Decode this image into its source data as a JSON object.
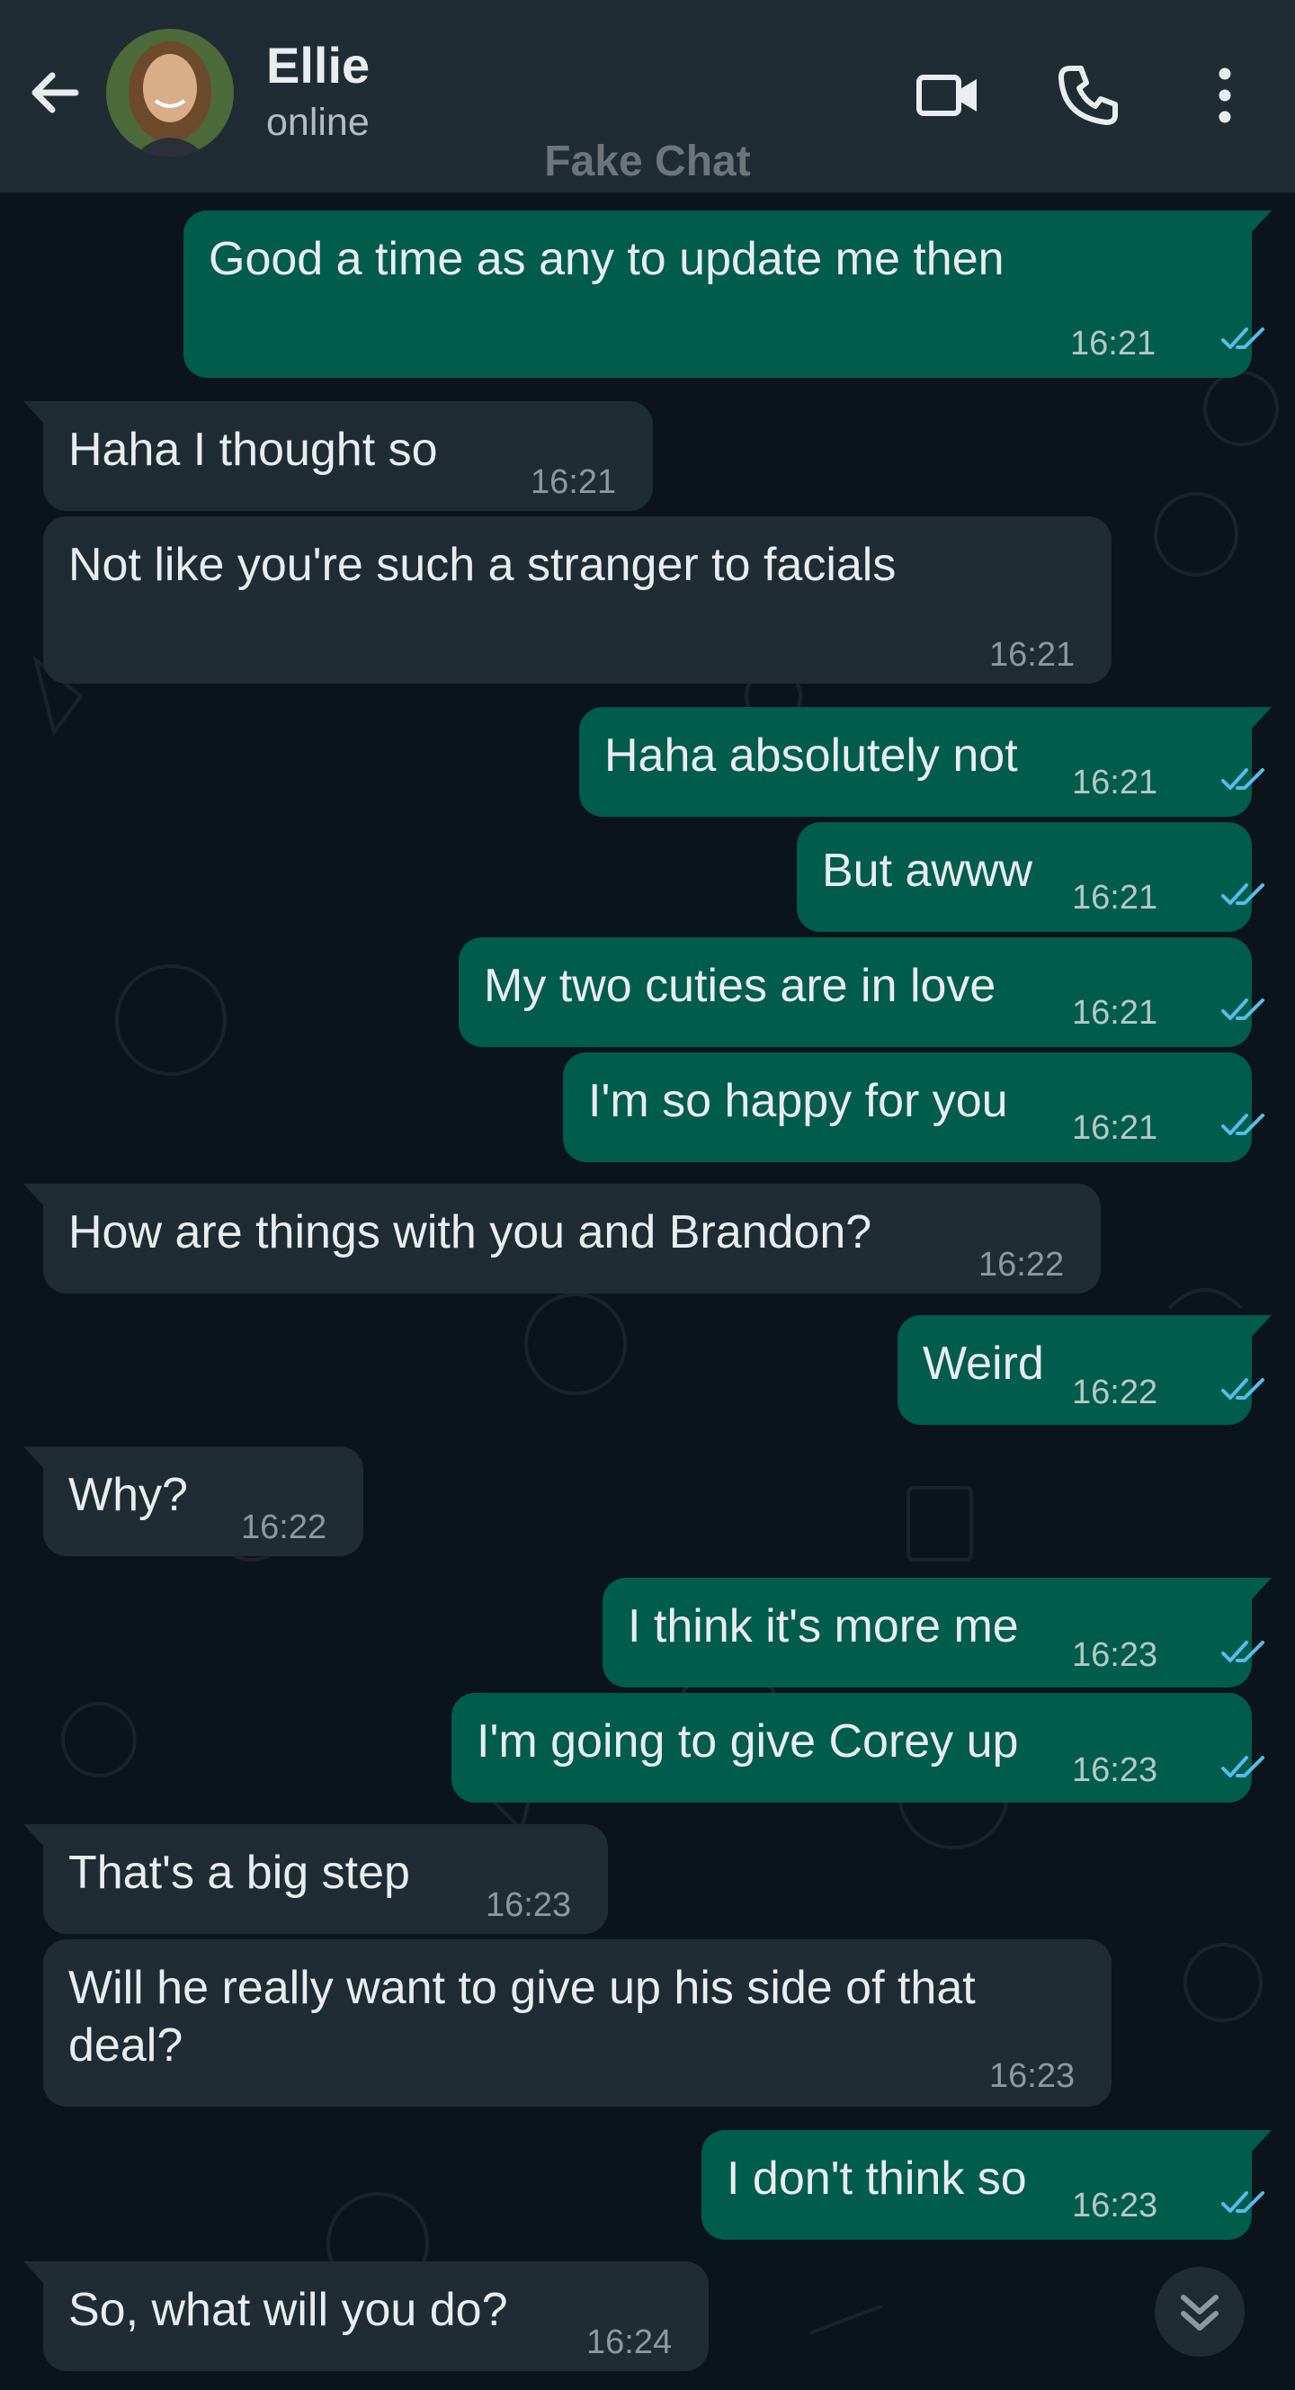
{
  "header": {
    "contact_name": "Ellie",
    "status": "online",
    "watermark": "Fake Chat",
    "icons": [
      "back-arrow-icon",
      "video-call-icon",
      "voice-call-icon",
      "more-options-icon"
    ]
  },
  "colors": {
    "header_bg": "#1f2c34",
    "chat_bg": "#0b141a",
    "outgoing_bubble": "#005c4b",
    "incoming_bubble": "#1f2c34",
    "read_ticks": "#53bdeb"
  },
  "messages": [
    {
      "direction": "out",
      "text": "Good a time as any to update me then",
      "time": "16:21",
      "read": true
    },
    {
      "direction": "in",
      "text": "Haha I thought so",
      "time": "16:21"
    },
    {
      "direction": "in",
      "text": "Not like you're such a stranger to facials",
      "time": "16:21"
    },
    {
      "direction": "out",
      "text": "Haha absolutely not",
      "time": "16:21",
      "read": true
    },
    {
      "direction": "out",
      "text": "But awww",
      "time": "16:21",
      "read": true
    },
    {
      "direction": "out",
      "text": "My two cuties are in love",
      "time": "16:21",
      "read": true
    },
    {
      "direction": "out",
      "text": "I'm so happy for you",
      "time": "16:21",
      "read": true
    },
    {
      "direction": "in",
      "text": "How are things with you and Brandon?",
      "time": "16:22"
    },
    {
      "direction": "out",
      "text": "Weird",
      "time": "16:22",
      "read": true
    },
    {
      "direction": "in",
      "text": "Why?",
      "time": "16:22"
    },
    {
      "direction": "out",
      "text": "I think it's more me",
      "time": "16:23",
      "read": true
    },
    {
      "direction": "out",
      "text": "I'm going to give Corey up",
      "time": "16:23",
      "read": true
    },
    {
      "direction": "in",
      "text": "That's a big step",
      "time": "16:23"
    },
    {
      "direction": "in",
      "text": "Will he really want to give up his side of that\ndeal?",
      "time": "16:23"
    },
    {
      "direction": "out",
      "text": "I don't think so",
      "time": "16:23",
      "read": true
    },
    {
      "direction": "in",
      "text": "So, what will you do?",
      "time": "16:24"
    }
  ],
  "scroll_button_icon": "double-chevron-down-icon"
}
